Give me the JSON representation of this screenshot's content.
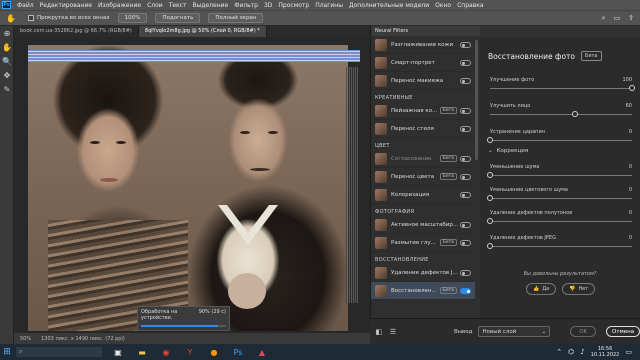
{
  "menubar": {
    "logo": "Ps",
    "items": [
      "Файл",
      "Редактирование",
      "Изображение",
      "Слои",
      "Текст",
      "Выделение",
      "Фильтр",
      "3D",
      "Просмотр",
      "Плагины",
      "Дополнительные модели",
      "Окно",
      "Справка"
    ]
  },
  "options": {
    "scroll_all": "Прокрутка во всех окнах",
    "zoom": "100%",
    "fit": "Подогнать",
    "fullscreen": "Полный экран"
  },
  "tabs": [
    {
      "label": "book.com.ua-352862.jpg @ 66,7% (RGB/8#)",
      "active": false
    },
    {
      "label": "8qlYvqIo2m8g.jpg @ 50% (Слой 0, RGB/8#) *",
      "active": true
    }
  ],
  "canvas": {
    "zoom": "50%",
    "doc_size": "1303 пикс. x 1490 пикс. (72 ppi)"
  },
  "progress": {
    "label": "Обработка на устройстве.",
    "value_text": "90% (29 с)",
    "fraction": 0.9
  },
  "neural": {
    "title": "Neural Filters",
    "rows": [
      {
        "label": "Разглаживание кожи",
        "toggle": false,
        "dim": false
      },
      {
        "label": "Смарт-портрет",
        "toggle": false,
        "dim": false
      },
      {
        "label": "Перенос макияжа",
        "toggle": false,
        "dim": false
      },
      {
        "category": "КРЕАТИВНЫЕ"
      },
      {
        "label": "Пейзажная ко...",
        "beta": "Бета",
        "toggle": false,
        "dim": false
      },
      {
        "label": "Перенос стиля",
        "toggle": false,
        "dim": false
      },
      {
        "category": "ЦВЕТ"
      },
      {
        "label": "Согласование",
        "beta": "Бета",
        "toggle": false,
        "dim": true
      },
      {
        "label": "Перенос цвета",
        "beta": "Бета",
        "toggle": false,
        "dim": false
      },
      {
        "label": "Колоризация",
        "toggle": false,
        "dim": false
      },
      {
        "category": "ФОТОГРАФИЯ"
      },
      {
        "label": "Активное масштабир...",
        "toggle": false,
        "dim": false
      },
      {
        "label": "Размытие глу...",
        "beta": "Бета",
        "toggle": false,
        "dim": false
      },
      {
        "category": "ВОССТАНОВЛЕНИЕ"
      },
      {
        "label": "Удаление дефектов J...",
        "toggle": false,
        "dim": false
      },
      {
        "label": "Восстановлен...",
        "beta": "Бета",
        "toggle": true,
        "dim": false,
        "selected": true
      }
    ]
  },
  "settings": {
    "title": "Восстановление фото",
    "beta": "Бета",
    "sliders": [
      {
        "label": "Улучшение фото",
        "value": "100",
        "fraction": 1.0
      },
      {
        "label": "Улучшить лицо",
        "value": "60",
        "fraction": 0.6
      },
      {
        "label": "Устранение царапин",
        "value": "0",
        "fraction": 0.0
      }
    ],
    "section": "Коррекция",
    "corr_sliders": [
      {
        "label": "Уменьшение шума",
        "value": "0",
        "fraction": 0.0
      },
      {
        "label": "Уменьшение цветового шума",
        "value": "0",
        "fraction": 0.0
      },
      {
        "label": "Удаление дефектов полутонов",
        "value": "0",
        "fraction": 0.0
      },
      {
        "label": "Удаление дефектов JPEG",
        "value": "0",
        "fraction": 0.0
      }
    ],
    "feedback_q": "Вы довольны результатом?",
    "yes": "Да",
    "no": "Нет"
  },
  "output": {
    "label": "Вывод",
    "value": "Новый слой",
    "ok": "OK",
    "cancel": "Отмена"
  },
  "taskbar": {
    "search_icon": "search-icon",
    "time": "16:56",
    "date": "10.11.2022"
  }
}
